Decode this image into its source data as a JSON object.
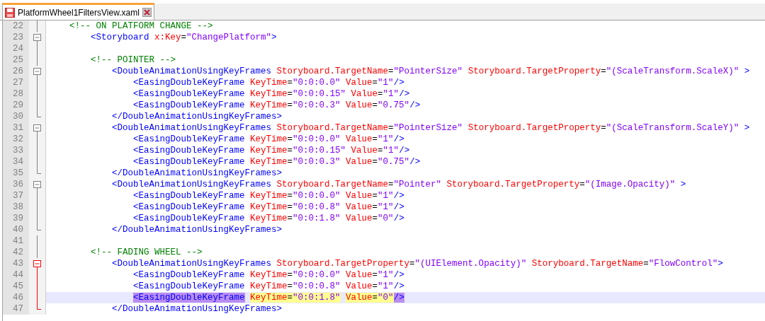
{
  "tabs": [
    {
      "label": "PlatformWheel1FiltersView.xaml",
      "selected": true
    }
  ],
  "lines": [
    {
      "number": "22",
      "kind": "body",
      "active": false,
      "current": false,
      "tokens": [
        {
          "kind": "comment",
          "t": "<!-- ON PLATFORM CHANGE -->"
        }
      ],
      "children": [
        {
          "number": "23",
          "kind": "open",
          "active": false,
          "current": false,
          "tokens": [
            {
              "kind": "tag",
              "t": "<Storyboard"
            },
            {
              "kind": "attr",
              "t": " x:Key"
            },
            {
              "kind": "eq",
              "t": "="
            },
            {
              "kind": "value",
              "t": "\"ChangePlatform\""
            },
            {
              "kind": "tag",
              "t": ">"
            }
          ]
        },
        {
          "number": "24",
          "kind": "body",
          "active": false,
          "current": false
        },
        {
          "number": "25",
          "kind": "body",
          "active": false,
          "current": false,
          "tokens": [
            {
              "kind": "comment",
              "t": "<!-- POINTER -->"
            }
          ],
          "children": [
            {
              "number": "26",
              "kind": "open",
              "active": false,
              "current": false,
              "tokens": [
                {
                  "kind": "tag",
                  "t": "<DoubleAnimationUsingKeyFrames"
                },
                {
                  "kind": "attr",
                  "t": " Storyboard.TargetName"
                },
                {
                  "kind": "eq",
                  "t": "="
                },
                {
                  "kind": "value",
                  "t": "\"PointerSize\""
                },
                {
                  "kind": "attr",
                  "t": " Storyboard.TargetProperty"
                },
                {
                  "kind": "eq",
                  "t": "="
                },
                {
                  "kind": "value",
                  "t": "\"(ScaleTransform.ScaleX)\""
                },
                {
                  "kind": "tag",
                  "t": " >"
                }
              ],
              "children": [
                {
                  "number": "27",
                  "kind": "body",
                  "active": false,
                  "current": false,
                  "tokens": [
                    {
                      "kind": "tag",
                      "t": "<EasingDoubleKeyFrame"
                    },
                    {
                      "kind": "attr",
                      "t": " KeyTime"
                    },
                    {
                      "kind": "eq",
                      "t": "="
                    },
                    {
                      "kind": "value",
                      "t": "\"0:0:0.0\""
                    },
                    {
                      "kind": "attr",
                      "t": " Value"
                    },
                    {
                      "kind": "eq",
                      "t": "="
                    },
                    {
                      "kind": "value",
                      "t": "\"1\""
                    },
                    {
                      "kind": "tag",
                      "t": "/>"
                    }
                  ]
                },
                {
                  "number": "28",
                  "kind": "body",
                  "active": false,
                  "current": false,
                  "tokens": [
                    {
                      "kind": "tag",
                      "t": "<EasingDoubleKeyFrame"
                    },
                    {
                      "kind": "attr",
                      "t": " KeyTime"
                    },
                    {
                      "kind": "eq",
                      "t": "="
                    },
                    {
                      "kind": "value",
                      "t": "\"0:0:0.15\""
                    },
                    {
                      "kind": "attr",
                      "t": " Value"
                    },
                    {
                      "kind": "eq",
                      "t": "="
                    },
                    {
                      "kind": "value",
                      "t": "\"1\""
                    },
                    {
                      "kind": "tag",
                      "t": "/>"
                    }
                  ]
                },
                {
                  "number": "29",
                  "kind": "body",
                  "active": false,
                  "current": false,
                  "tokens": [
                    {
                      "kind": "tag",
                      "t": "<EasingDoubleKeyFrame"
                    },
                    {
                      "kind": "attr",
                      "t": " KeyTime"
                    },
                    {
                      "kind": "eq",
                      "t": "="
                    },
                    {
                      "kind": "value",
                      "t": "\"0:0:0.3\""
                    },
                    {
                      "kind": "attr",
                      "t": " Value"
                    },
                    {
                      "kind": "eq",
                      "t": "="
                    },
                    {
                      "kind": "value",
                      "t": "\"0.75\""
                    },
                    {
                      "kind": "tag",
                      "t": "/>"
                    }
                  ]
                }
              ]
            },
            {
              "number": "30",
              "kind": "end",
              "active": false,
              "current": false,
              "tokens": [
                {
                  "kind": "tag",
                  "t": "</DoubleAnimationUsingKeyFrames>"
                }
              ]
            },
            {
              "number": "31",
              "kind": "open",
              "active": false,
              "current": false,
              "tokens": [
                {
                  "kind": "tag",
                  "t": "<DoubleAnimationUsingKeyFrames"
                },
                {
                  "kind": "attr",
                  "t": " Storyboard.TargetName"
                },
                {
                  "kind": "eq",
                  "t": "="
                },
                {
                  "kind": "value",
                  "t": "\"PointerSize\""
                },
                {
                  "kind": "attr",
                  "t": " Storyboard.TargetProperty"
                },
                {
                  "kind": "eq",
                  "t": "="
                },
                {
                  "kind": "value",
                  "t": "\"(ScaleTransform.ScaleY)\""
                },
                {
                  "kind": "tag",
                  "t": " >"
                }
              ],
              "children": [
                {
                  "number": "32",
                  "kind": "body",
                  "active": false,
                  "current": false,
                  "tokens": [
                    {
                      "kind": "tag",
                      "t": "<EasingDoubleKeyFrame"
                    },
                    {
                      "kind": "attr",
                      "t": " KeyTime"
                    },
                    {
                      "kind": "eq",
                      "t": "="
                    },
                    {
                      "kind": "value",
                      "t": "\"0:0:0.0\""
                    },
                    {
                      "kind": "attr",
                      "t": " Value"
                    },
                    {
                      "kind": "eq",
                      "t": "="
                    },
                    {
                      "kind": "value",
                      "t": "\"1\""
                    },
                    {
                      "kind": "tag",
                      "t": "/>"
                    }
                  ]
                },
                {
                  "number": "33",
                  "kind": "body",
                  "active": false,
                  "current": false,
                  "tokens": [
                    {
                      "kind": "tag",
                      "t": "<EasingDoubleKeyFrame"
                    },
                    {
                      "kind": "attr",
                      "t": " KeyTime"
                    },
                    {
                      "kind": "eq",
                      "t": "="
                    },
                    {
                      "kind": "value",
                      "t": "\"0:0:0.15\""
                    },
                    {
                      "kind": "attr",
                      "t": " Value"
                    },
                    {
                      "kind": "eq",
                      "t": "="
                    },
                    {
                      "kind": "value",
                      "t": "\"1\""
                    },
                    {
                      "kind": "tag",
                      "t": "/>"
                    }
                  ]
                },
                {
                  "number": "34",
                  "kind": "body",
                  "active": false,
                  "current": false,
                  "tokens": [
                    {
                      "kind": "tag",
                      "t": "<EasingDoubleKeyFrame"
                    },
                    {
                      "kind": "attr",
                      "t": " KeyTime"
                    },
                    {
                      "kind": "eq",
                      "t": "="
                    },
                    {
                      "kind": "value",
                      "t": "\"0:0:0.3\""
                    },
                    {
                      "kind": "attr",
                      "t": " Value"
                    },
                    {
                      "kind": "eq",
                      "t": "="
                    },
                    {
                      "kind": "value",
                      "t": "\"0.75\""
                    },
                    {
                      "kind": "tag",
                      "t": "/>"
                    }
                  ]
                }
              ]
            },
            {
              "number": "35",
              "kind": "end",
              "active": false,
              "current": false,
              "tokens": [
                {
                  "kind": "tag",
                  "t": "</DoubleAnimationUsingKeyFrames>"
                }
              ]
            },
            {
              "number": "36",
              "kind": "open",
              "active": false,
              "current": false,
              "tokens": [
                {
                  "kind": "tag",
                  "t": "<DoubleAnimationUsingKeyFrames"
                },
                {
                  "kind": "attr",
                  "t": " Storyboard.TargetName"
                },
                {
                  "kind": "eq",
                  "t": "="
                },
                {
                  "kind": "value",
                  "t": "\"Pointer\""
                },
                {
                  "kind": "attr",
                  "t": " Storyboard.TargetProperty"
                },
                {
                  "kind": "eq",
                  "t": "="
                },
                {
                  "kind": "value",
                  "t": "\"(Image.Opacity)\""
                },
                {
                  "kind": "tag",
                  "t": " >"
                }
              ],
              "children": [
                {
                  "number": "37",
                  "kind": "body",
                  "active": false,
                  "current": false,
                  "tokens": [
                    {
                      "kind": "tag",
                      "t": "<EasingDoubleKeyFrame"
                    },
                    {
                      "kind": "attr",
                      "t": " KeyTime"
                    },
                    {
                      "kind": "eq",
                      "t": "="
                    },
                    {
                      "kind": "value",
                      "t": "\"0:0:0.0\""
                    },
                    {
                      "kind": "attr",
                      "t": " Value"
                    },
                    {
                      "kind": "eq",
                      "t": "="
                    },
                    {
                      "kind": "value",
                      "t": "\"1\""
                    },
                    {
                      "kind": "tag",
                      "t": "/>"
                    }
                  ]
                },
                {
                  "number": "38",
                  "kind": "body",
                  "active": false,
                  "current": false,
                  "tokens": [
                    {
                      "kind": "tag",
                      "t": "<EasingDoubleKeyFrame"
                    },
                    {
                      "kind": "attr",
                      "t": " KeyTime"
                    },
                    {
                      "kind": "eq",
                      "t": "="
                    },
                    {
                      "kind": "value",
                      "t": "\"0:0:0.8\""
                    },
                    {
                      "kind": "attr",
                      "t": " Value"
                    },
                    {
                      "kind": "eq",
                      "t": "="
                    },
                    {
                      "kind": "value",
                      "t": "\"1\""
                    },
                    {
                      "kind": "tag",
                      "t": "/>"
                    }
                  ]
                },
                {
                  "number": "39",
                  "kind": "body",
                  "active": false,
                  "current": false,
                  "tokens": [
                    {
                      "kind": "tag",
                      "t": "<EasingDoubleKeyFrame"
                    },
                    {
                      "kind": "attr",
                      "t": " KeyTime"
                    },
                    {
                      "kind": "eq",
                      "t": "="
                    },
                    {
                      "kind": "value",
                      "t": "\"0:0:1.8\""
                    },
                    {
                      "kind": "attr",
                      "t": " Value"
                    },
                    {
                      "kind": "eq",
                      "t": "="
                    },
                    {
                      "kind": "value",
                      "t": "\"0\""
                    },
                    {
                      "kind": "tag",
                      "t": "/>"
                    }
                  ]
                }
              ]
            },
            {
              "number": "40",
              "kind": "end",
              "active": false,
              "current": false,
              "tokens": [
                {
                  "kind": "tag",
                  "t": "</DoubleAnimationUsingKeyFrames>"
                }
              ]
            },
            {
              "number": "41",
              "kind": "body",
              "active": false,
              "current": false
            }
          ]
        },
        {
          "number": "42",
          "kind": "body",
          "active": false,
          "current": false,
          "tokens": [
            {
              "kind": "comment",
              "t": "<!-- FADING WHEEL -->"
            }
          ],
          "children": [
            {
              "number": "43",
              "kind": "open",
              "active": true,
              "current": false,
              "tokens": [
                {
                  "kind": "tag",
                  "t": "<DoubleAnimationUsingKeyFrames"
                },
                {
                  "kind": "attr",
                  "t": " Storyboard.TargetProperty"
                },
                {
                  "kind": "eq",
                  "t": "="
                },
                {
                  "kind": "value",
                  "t": "\"(UIElement.Opacity)\""
                },
                {
                  "kind": "attr",
                  "t": " Storyboard.TargetName"
                },
                {
                  "kind": "eq",
                  "t": "="
                },
                {
                  "kind": "value",
                  "t": "\"FlowControl\""
                },
                {
                  "kind": "tag",
                  "t": ">"
                }
              ],
              "children": [
                {
                  "number": "44",
                  "kind": "body",
                  "active": true,
                  "current": false,
                  "tokens": [
                    {
                      "kind": "tag",
                      "t": "<EasingDoubleKeyFrame"
                    },
                    {
                      "kind": "attr",
                      "t": " KeyTime"
                    },
                    {
                      "kind": "eq",
                      "t": "="
                    },
                    {
                      "kind": "value",
                      "t": "\"0:0:0.0\""
                    },
                    {
                      "kind": "attr",
                      "t": " Value"
                    },
                    {
                      "kind": "eq",
                      "t": "="
                    },
                    {
                      "kind": "value",
                      "t": "\"1\""
                    },
                    {
                      "kind": "tag",
                      "t": "/>"
                    }
                  ]
                },
                {
                  "number": "45",
                  "kind": "body",
                  "active": true,
                  "current": false,
                  "tokens": [
                    {
                      "kind": "tag",
                      "t": "<EasingDoubleKeyFrame"
                    },
                    {
                      "kind": "attr",
                      "t": " KeyTime"
                    },
                    {
                      "kind": "eq",
                      "t": "="
                    },
                    {
                      "kind": "value",
                      "t": "\"0:0:0.8\""
                    },
                    {
                      "kind": "attr",
                      "t": " Value"
                    },
                    {
                      "kind": "eq",
                      "t": "="
                    },
                    {
                      "kind": "value",
                      "t": "\"1\""
                    },
                    {
                      "kind": "tag",
                      "t": "/>"
                    }
                  ]
                },
                {
                  "number": "46",
                  "kind": "body",
                  "active": true,
                  "current": true,
                  "tokens": [
                    {
                      "kind": "tag",
                      "t": "<EasingDoubleKeyFrame",
                      "tag_match": true,
                      "smart_highlight": false
                    },
                    {
                      "kind": "attr",
                      "t": "KeyTime",
                      "tag_match": false,
                      "smart_highlight": true
                    },
                    {
                      "kind": "eq",
                      "t": "=",
                      "tag_match": false,
                      "smart_highlight": true
                    },
                    {
                      "kind": "value",
                      "t": "\"0:0:1.8\"",
                      "tag_match": false,
                      "smart_highlight": true
                    },
                    {
                      "kind": "attr",
                      "t": "Value",
                      "tag_match": false,
                      "smart_highlight": true
                    },
                    {
                      "kind": "eq",
                      "t": "=",
                      "tag_match": false,
                      "smart_highlight": true
                    },
                    {
                      "kind": "value",
                      "t": "\"0\"",
                      "tag_match": false,
                      "smart_highlight": true
                    },
                    {
                      "kind": "tag",
                      "t": "/>",
                      "tag_match": true,
                      "smart_highlight": false
                    }
                  ]
                }
              ]
            },
            {
              "number": "47",
              "kind": "end",
              "active": true,
              "current": false,
              "tokens": [
                {
                  "kind": "tag",
                  "t": "</DoubleAnimationUsingKeyFrames>"
                }
              ]
            }
          ]
        }
      ]
    }
  ]
}
